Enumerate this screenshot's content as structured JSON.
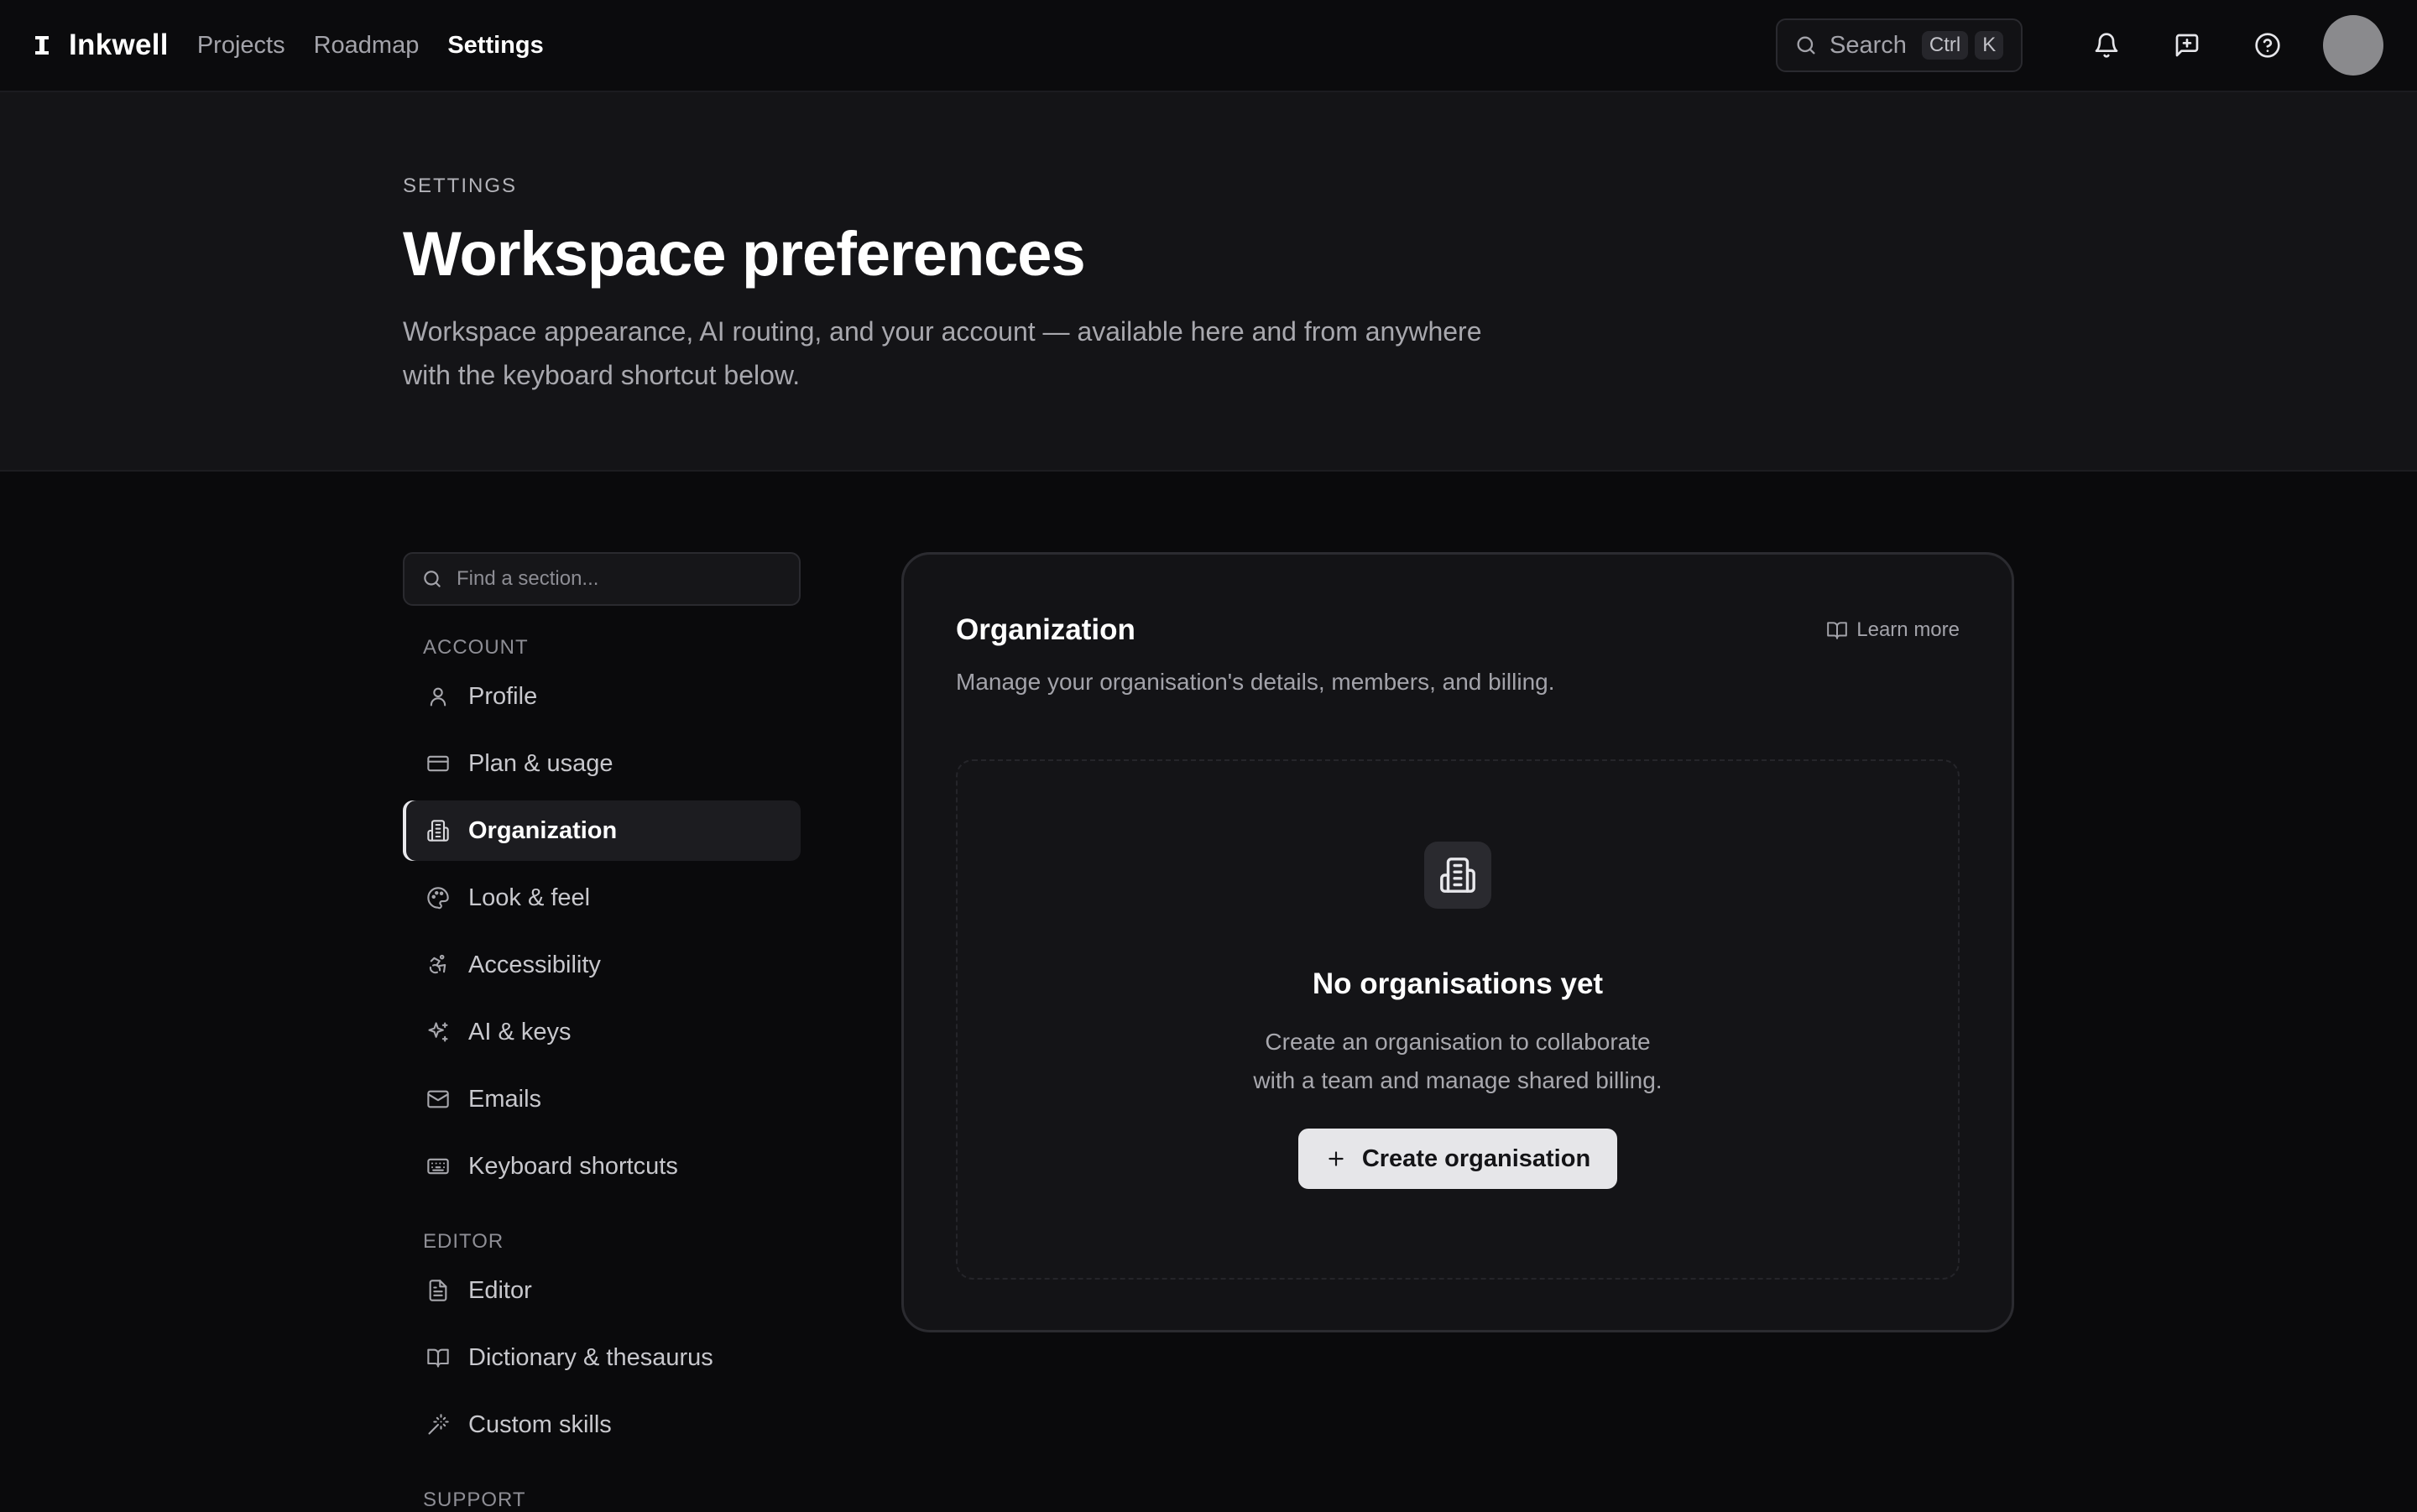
{
  "app": {
    "name": "Inkwell"
  },
  "nav": [
    {
      "label": "Projects",
      "active": false
    },
    {
      "label": "Roadmap",
      "active": false
    },
    {
      "label": "Settings",
      "active": true
    }
  ],
  "search": {
    "label": "Search",
    "shortcut": [
      "Ctrl",
      "K"
    ]
  },
  "topbar_icons": [
    "bell-icon",
    "message-plus-icon",
    "help-circle-icon"
  ],
  "hero": {
    "eyebrow": "SETTINGS",
    "title": "Workspace preferences",
    "description_line1": "Workspace appearance, AI routing, and your account — available here and from anywhere",
    "description_line2": "with the keyboard shortcut below."
  },
  "sidebar": {
    "find_placeholder": "Find a section...",
    "groups": [
      {
        "title": "ACCOUNT",
        "items": [
          {
            "label": "Profile",
            "icon": "user-icon"
          },
          {
            "label": "Plan & usage",
            "icon": "credit-card-icon"
          },
          {
            "label": "Organization",
            "icon": "building-icon",
            "active": true
          },
          {
            "label": "Look & feel",
            "icon": "palette-icon"
          },
          {
            "label": "Accessibility",
            "icon": "accessibility-icon"
          },
          {
            "label": "AI & keys",
            "icon": "sparkles-icon"
          },
          {
            "label": "Emails",
            "icon": "mail-icon"
          },
          {
            "label": "Keyboard shortcuts",
            "icon": "keyboard-icon"
          }
        ]
      },
      {
        "title": "EDITOR",
        "items": [
          {
            "label": "Editor",
            "icon": "file-text-icon"
          },
          {
            "label": "Dictionary & thesaurus",
            "icon": "book-open-icon"
          },
          {
            "label": "Custom skills",
            "icon": "wand-icon"
          }
        ]
      },
      {
        "title": "SUPPORT",
        "items": []
      }
    ]
  },
  "card": {
    "title": "Organization",
    "learn_more": "Learn more",
    "subtitle": "Manage your organisation's details, members, and billing.",
    "empty": {
      "title": "No organisations yet",
      "description_line1": "Create an organisation to collaborate",
      "description_line2": "with a team and manage shared billing.",
      "button": "Create organisation"
    }
  }
}
